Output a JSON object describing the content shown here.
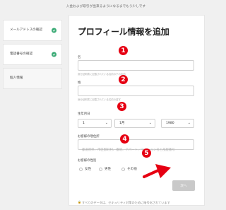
{
  "top_notice": "入金および取引が出来るようになるまでもう少しです",
  "sidebar": {
    "items": [
      {
        "label": "メールアドレスの確認",
        "done": true
      },
      {
        "label": "電話番号の確認",
        "done": true
      },
      {
        "label": "個人情報",
        "done": false
      }
    ]
  },
  "form": {
    "title": "プロフィール情報を追加",
    "first_name": {
      "label": "名",
      "value": "",
      "placeholder": "",
      "hint": "身分証明書に記載されている名前の下の名前"
    },
    "last_name": {
      "label": "姓",
      "value": "",
      "placeholder": "",
      "hint": "身分証明書に記載されている名前の苗字"
    },
    "birthdate": {
      "label": "生年月日",
      "day": "1",
      "month": "1月",
      "year": "1980"
    },
    "address": {
      "label": "お客様の現住所",
      "value": "",
      "placeholder": "都道府県、市区郡町村、番地、アパート／マンション名と部屋番号"
    },
    "gender": {
      "label": "お客様の性別",
      "options": [
        "女性",
        "男性",
        "その他"
      ]
    },
    "next_button": "次へ",
    "security_notice": "すべてのデータは、セキュリティ対策のために暗号化されています"
  },
  "annotations": {
    "markers": [
      "1",
      "2",
      "3",
      "4",
      "5"
    ],
    "marker_color": "#e60012",
    "arrow_color": "#e60012"
  }
}
